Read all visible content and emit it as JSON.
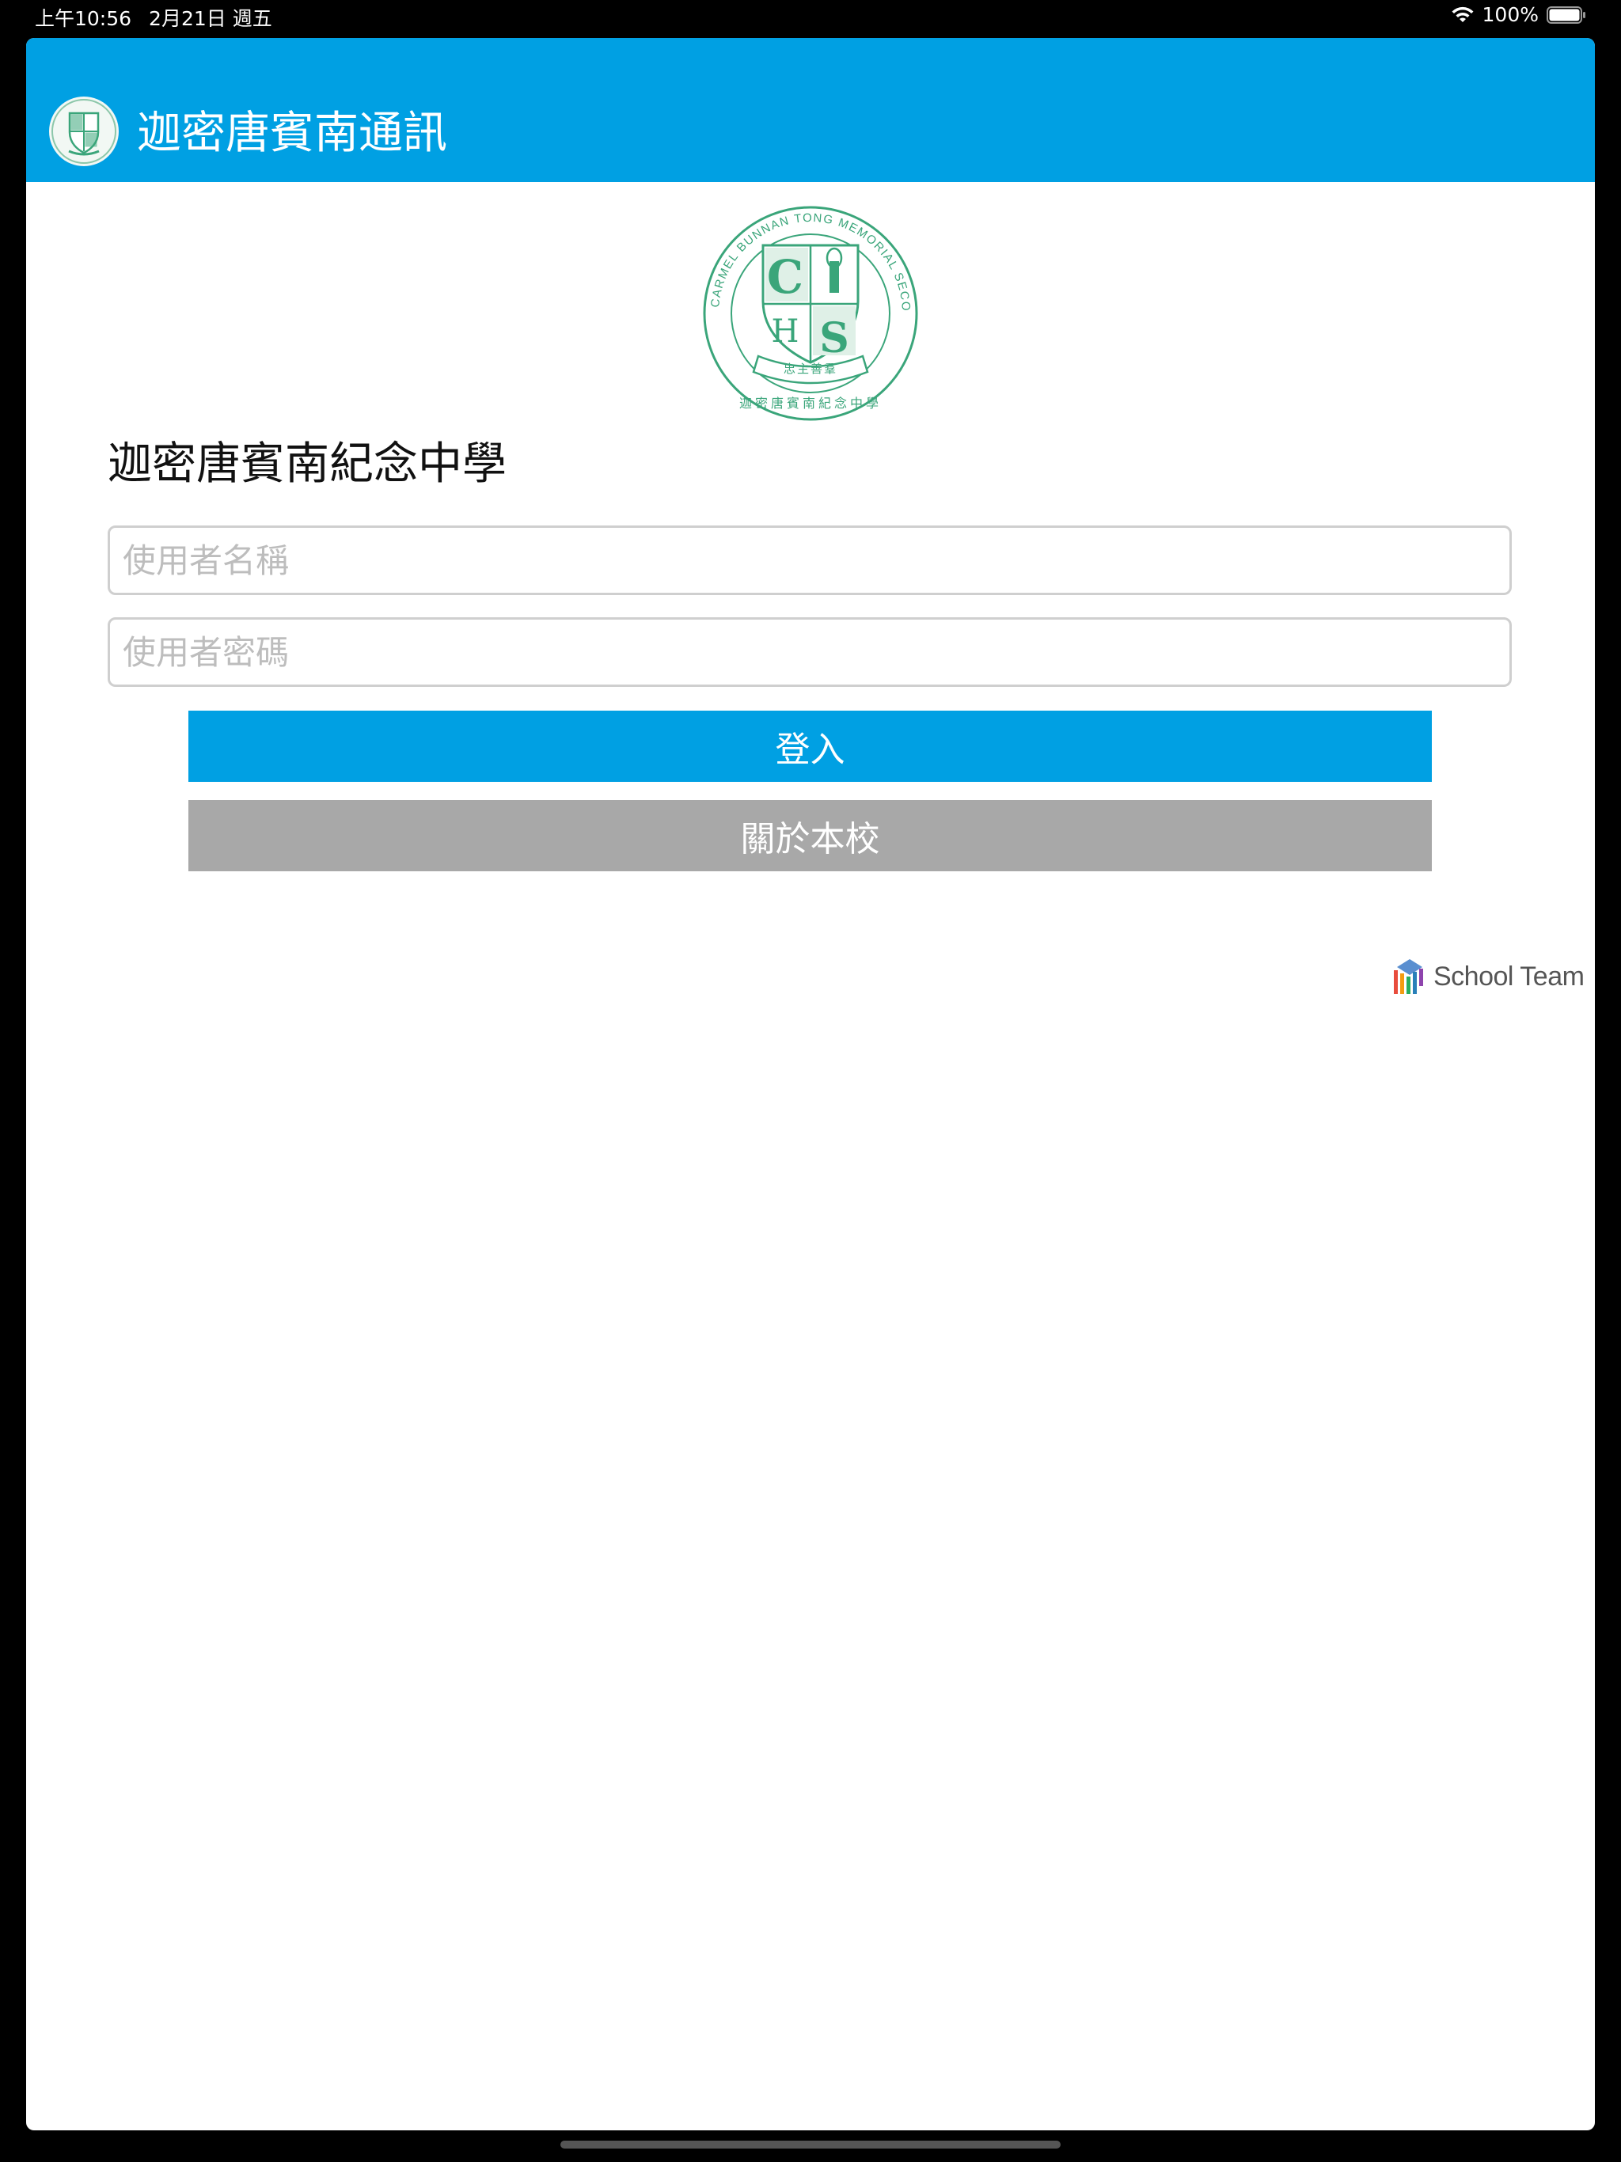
{
  "status_bar": {
    "time": "上午10:56",
    "date": "2月21日 週五",
    "battery": "100%",
    "icons": [
      "wifi-icon",
      "battery-icon"
    ]
  },
  "nav": {
    "title": "迦密唐賓南通訊",
    "logo_icon": "school-crest-icon"
  },
  "login": {
    "school_name": "迦密唐賓南紀念中學",
    "username_placeholder": "使用者名稱",
    "password_placeholder": "使用者密碼",
    "login_label": "登入",
    "about_label": "關於本校"
  },
  "crest": {
    "ring_text": "CARMEL BUNNAN TONG MEMORIAL SECONDARY SCHOOL",
    "bottom_text": "迦密唐賓南紀念中學",
    "motto": "忠主善羣",
    "left_letter": "C",
    "right_letter": "S",
    "left_bottom_letter": "H"
  },
  "brand": {
    "text": "School Team",
    "icon": "school-team-logo-icon"
  },
  "colors": {
    "accent": "#00a0e3",
    "secondary_button": "#a8a8a8",
    "crest_green": "#3aa57a"
  }
}
